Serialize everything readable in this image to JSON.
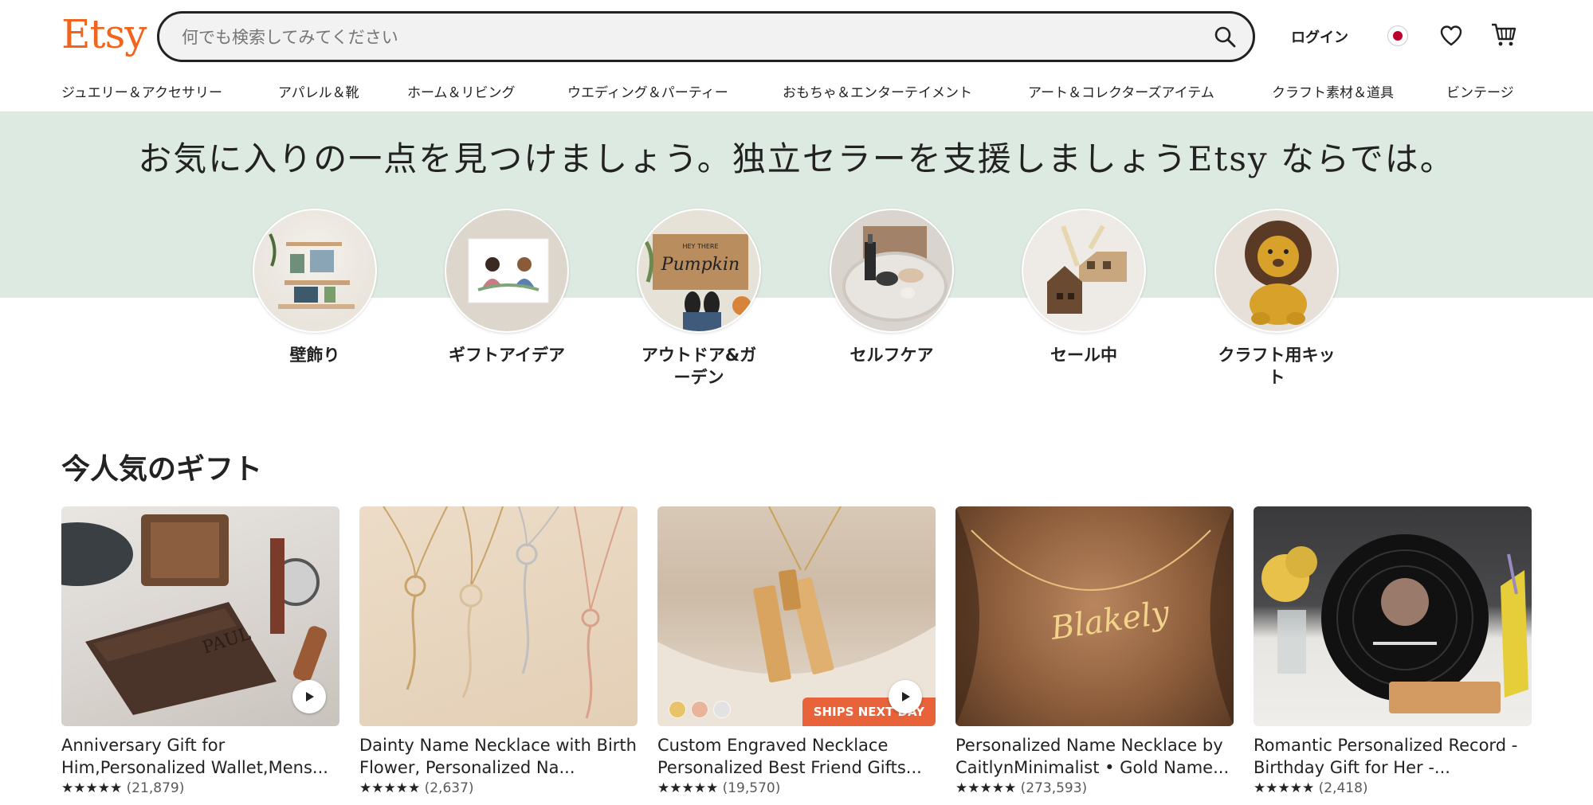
{
  "header": {
    "logo": "Etsy",
    "search_placeholder": "何でも検索してみてください",
    "login_label": "ログイン"
  },
  "nav": {
    "items": [
      "ジュエリー＆アクセサリー",
      "アパレル＆靴",
      "ホーム＆リビング",
      "ウエディング＆パーティー",
      "おもちゃ＆エンターテイメント",
      "アート＆コレクターズアイテム",
      "クラフト素材＆道具",
      "ビンテージ"
    ]
  },
  "hero": {
    "title": "お気に入りの一点を見つけましょう。独立セラーを支援しましょうEtsy ならでは。"
  },
  "categories": [
    {
      "label": "壁飾り"
    },
    {
      "label": "ギフトアイデア"
    },
    {
      "label": "アウトドア&ガーデン"
    },
    {
      "label": "セルフケア"
    },
    {
      "label": "セール中"
    },
    {
      "label": "クラフト用キット"
    }
  ],
  "popular": {
    "title": "今人気のギフト",
    "items": [
      {
        "title": "Anniversary Gift for Him,Personalized Wallet,Mens...",
        "stars": "★★★★★",
        "reviews": "(21,879)"
      },
      {
        "title": "Dainty Name Necklace with Birth Flower, Personalized Na...",
        "stars": "★★★★★",
        "reviews": "(2,637)"
      },
      {
        "title": "Custom Engraved Necklace Personalized Best Friend Gifts...",
        "stars": "★★★★★",
        "reviews": "(19,570)",
        "badge": "SHIPS NEXT DAY"
      },
      {
        "title": "Personalized Name Necklace by CaitlynMinimalist • Gold Name...",
        "stars": "★★★★★",
        "reviews": "(273,593)"
      },
      {
        "title": "Romantic Personalized Record - Birthday Gift for Her -...",
        "stars": "★★★★★",
        "reviews": "(2,418)"
      }
    ]
  },
  "colors": {
    "brand": "#F1641E",
    "hero_bg": "#DDEAE1"
  }
}
